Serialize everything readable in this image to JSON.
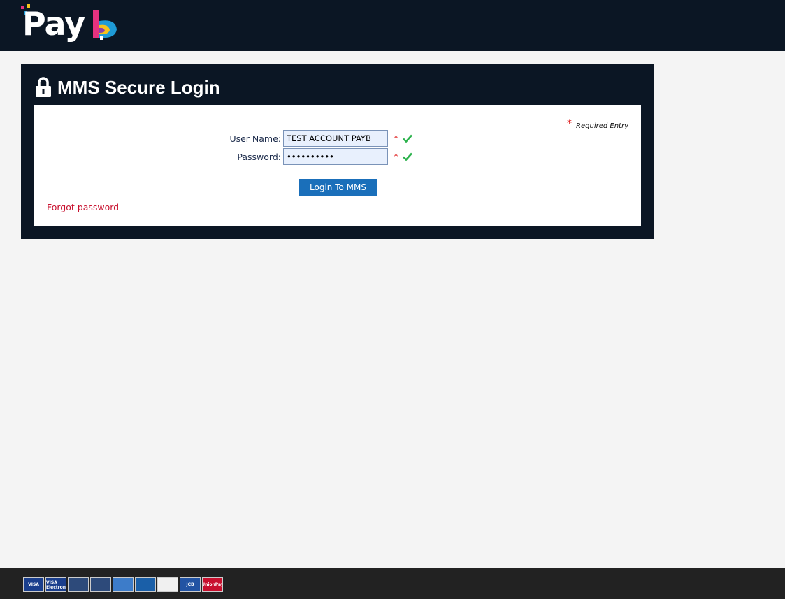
{
  "header": {
    "logo_text": "Pay",
    "colors": {
      "background": "#0b1624",
      "logo_pink": "#e5327f",
      "logo_blue": "#1e9ad6",
      "logo_yellow": "#f6c21b"
    }
  },
  "login_panel": {
    "title": "MMS Secure Login",
    "lock_icon": "lock-icon",
    "required_note": "Required Entry",
    "required_marker": "*",
    "fields": {
      "username": {
        "label": "User Name:",
        "value": "TEST ACCOUNT PAYB"
      },
      "password": {
        "label": "Password:",
        "value": "••••••••••"
      }
    },
    "login_button": "Login To MMS",
    "forgot_link": "Forgot password",
    "colors": {
      "button": "#1a6fba",
      "link": "#c8102e",
      "required": "#e02020",
      "valid": "#2bb24c"
    }
  },
  "footer": {
    "cards": [
      {
        "name": "visa",
        "text": "VISA",
        "bg": "#1a3e8c"
      },
      {
        "name": "visa-electron",
        "text": "VISA Electron",
        "bg": "#1a3e8c"
      },
      {
        "name": "mastercard",
        "text": "",
        "bg": "#2d4a7a"
      },
      {
        "name": "maestro",
        "text": "",
        "bg": "#2d4a7a"
      },
      {
        "name": "american-express",
        "text": "",
        "bg": "#3d7cc9"
      },
      {
        "name": "diners-club",
        "text": "",
        "bg": "#1a5fa8"
      },
      {
        "name": "delta",
        "text": "",
        "bg": "#f0f0f0"
      },
      {
        "name": "jcb",
        "text": "JCB",
        "bg": "#2253a3"
      },
      {
        "name": "unionpay",
        "text": "UnionPay",
        "bg": "#c8102e"
      }
    ]
  }
}
